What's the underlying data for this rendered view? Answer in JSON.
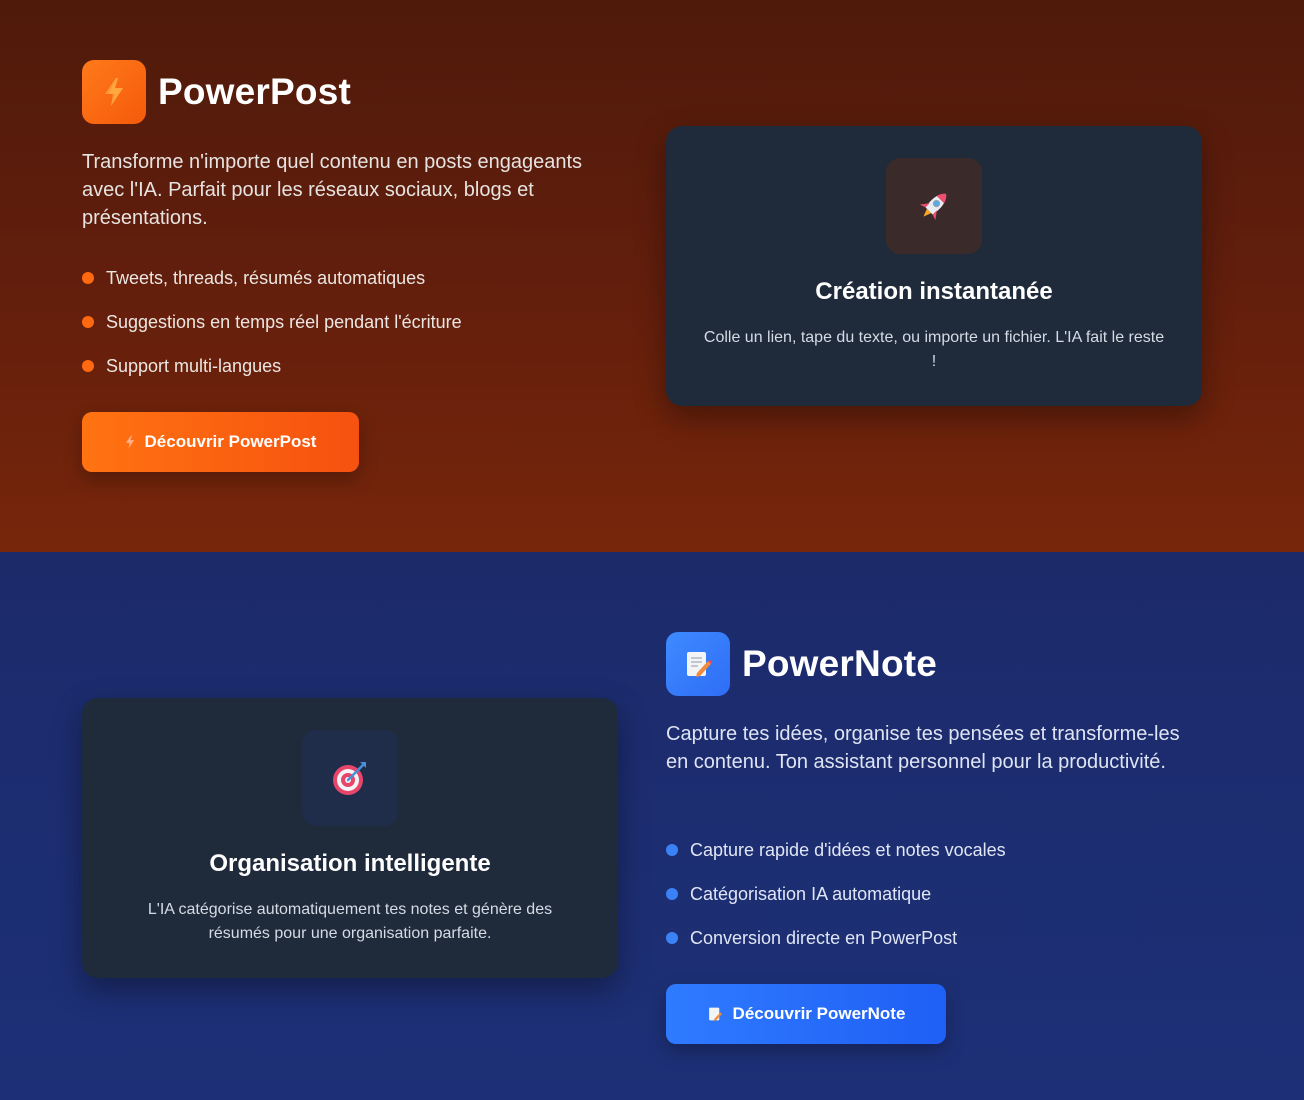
{
  "powerpost": {
    "title": "PowerPost",
    "description": "Transforme n'importe quel contenu en posts engageants avec l'IA. Parfait pour les réseaux sociaux, blogs et présentations.",
    "features": [
      "Tweets, threads, résumés automatiques",
      "Suggestions en temps réel pendant l'écriture",
      "Support multi-langues"
    ],
    "cta_label": "Découvrir PowerPost",
    "card": {
      "icon": "rocket-icon",
      "title": "Création instantanée",
      "text": "Colle un lien, tape du texte, ou importe un fichier. L'IA fait le reste !"
    },
    "accent_color": "#ff6a10"
  },
  "powernote": {
    "title": "PowerNote",
    "description": "Capture tes idées, organise tes pensées et transforme-les en contenu. Ton assistant personnel pour la productivité.",
    "features": [
      "Capture rapide d'idées et notes vocales",
      "Catégorisation IA automatique",
      "Conversion directe en PowerPost"
    ],
    "cta_label": "Découvrir PowerNote",
    "card": {
      "icon": "target-icon",
      "title": "Organisation intelligente",
      "text": "L'IA catégorise automatiquement tes notes et génère des résumés pour une organisation parfaite."
    },
    "accent_color": "#3b82f6"
  }
}
